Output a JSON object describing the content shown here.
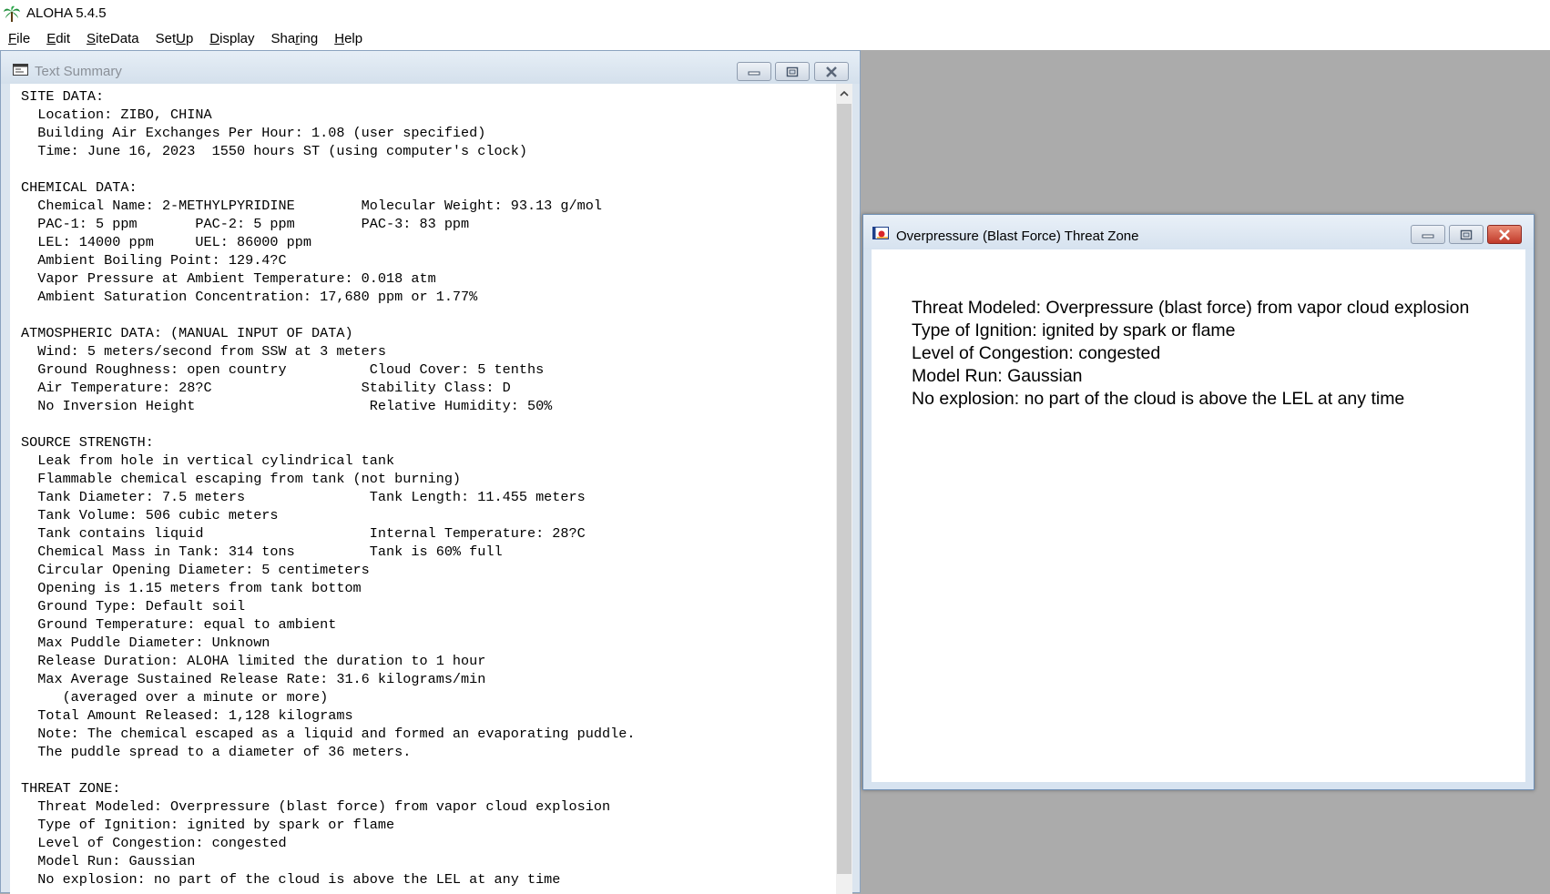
{
  "app": {
    "title": "ALOHA 5.4.5"
  },
  "menu": [
    {
      "mnemonic": "F",
      "rest": "ile"
    },
    {
      "mnemonic": "E",
      "rest": "dit"
    },
    {
      "mnemonic": "S",
      "rest": "iteData"
    },
    {
      "mnemonic": "S",
      "rest": "etUp",
      "pre": "Set",
      "post": "p",
      "underline_index": 3
    },
    {
      "mnemonic": "D",
      "rest": "isplay"
    },
    {
      "mnemonic": "r",
      "rest": "ing",
      "pre": "Sha"
    },
    {
      "mnemonic": "H",
      "rest": "elp"
    }
  ],
  "menu_labels": {
    "file": {
      "pre": "",
      "mn": "F",
      "post": "ile"
    },
    "edit": {
      "pre": "",
      "mn": "E",
      "post": "dit"
    },
    "sitedata": {
      "pre": "",
      "mn": "S",
      "post": "iteData"
    },
    "setup": {
      "pre": "Set",
      "mn": "U",
      "post": "p"
    },
    "display": {
      "pre": "",
      "mn": "D",
      "post": "isplay"
    },
    "sharing": {
      "pre": "Sha",
      "mn": "r",
      "post": "ing"
    },
    "help": {
      "pre": "",
      "mn": "H",
      "post": "elp"
    }
  },
  "text_summary": {
    "title": "Text Summary",
    "lines": [
      "SITE DATA:",
      "  Location: ZIBO, CHINA",
      "  Building Air Exchanges Per Hour: 1.08 (user specified)",
      "  Time: June 16, 2023  1550 hours ST (using computer's clock)",
      "",
      "CHEMICAL DATA:",
      "  Chemical Name: 2-METHYLPYRIDINE        Molecular Weight: 93.13 g/mol",
      "  PAC-1: 5 ppm       PAC-2: 5 ppm        PAC-3: 83 ppm",
      "  LEL: 14000 ppm     UEL: 86000 ppm",
      "  Ambient Boiling Point: 129.4?C",
      "  Vapor Pressure at Ambient Temperature: 0.018 atm",
      "  Ambient Saturation Concentration: 17,680 ppm or 1.77%",
      "",
      "ATMOSPHERIC DATA: (MANUAL INPUT OF DATA)",
      "  Wind: 5 meters/second from SSW at 3 meters",
      "  Ground Roughness: open country          Cloud Cover: 5 tenths",
      "  Air Temperature: 28?C                  Stability Class: D",
      "  No Inversion Height                     Relative Humidity: 50%",
      "",
      "SOURCE STRENGTH:",
      "  Leak from hole in vertical cylindrical tank",
      "  Flammable chemical escaping from tank (not burning)",
      "  Tank Diameter: 7.5 meters               Tank Length: 11.455 meters",
      "  Tank Volume: 506 cubic meters",
      "  Tank contains liquid                    Internal Temperature: 28?C",
      "  Chemical Mass in Tank: 314 tons         Tank is 60% full",
      "  Circular Opening Diameter: 5 centimeters",
      "  Opening is 1.15 meters from tank bottom",
      "  Ground Type: Default soil",
      "  Ground Temperature: equal to ambient",
      "  Max Puddle Diameter: Unknown",
      "  Release Duration: ALOHA limited the duration to 1 hour",
      "  Max Average Sustained Release Rate: 31.6 kilograms/min",
      "     (averaged over a minute or more)",
      "  Total Amount Released: 1,128 kilograms",
      "  Note: The chemical escaped as a liquid and formed an evaporating puddle.",
      "  The puddle spread to a diameter of 36 meters.",
      "",
      "THREAT ZONE:",
      "  Threat Modeled: Overpressure (blast force) from vapor cloud explosion",
      "  Type of Ignition: ignited by spark or flame",
      "  Level of Congestion: congested",
      "  Model Run: Gaussian",
      "  No explosion: no part of the cloud is above the LEL at any time"
    ]
  },
  "threat_zone": {
    "title": "Overpressure (Blast Force) Threat Zone",
    "lines": [
      "Threat Modeled: Overpressure (blast force) from vapor cloud explosion",
      "Type of Ignition: ignited by spark or flame",
      "Level of Congestion: congested",
      "Model Run: Gaussian",
      "No explosion: no part of the cloud is above the LEL at any time"
    ]
  }
}
